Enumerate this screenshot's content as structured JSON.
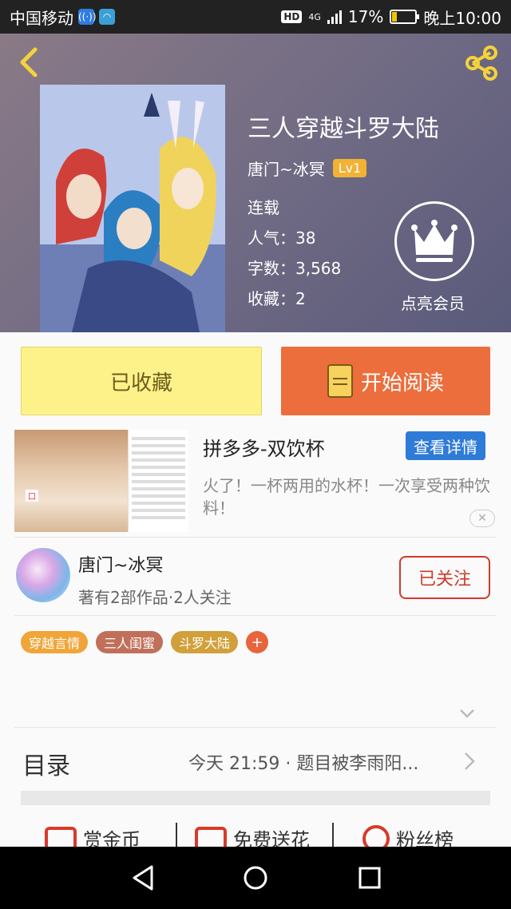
{
  "status_bar": {
    "carrier": "中国移动",
    "network": "4G",
    "battery": "17%",
    "time": "晚上10:00"
  },
  "book": {
    "title": "三人穿越斗罗大陆",
    "author": "唐门~冰冥",
    "level": "Lv1",
    "status": "连载",
    "popularity": "人气：38",
    "word_count": "字数：3,568",
    "favorites": "收藏：2",
    "member_label": "点亮会员"
  },
  "buttons": {
    "collect": "已收藏",
    "read": "开始阅读"
  },
  "ad": {
    "title": "拼多多-双饮杯",
    "detail_button": "查看详情",
    "description": "火了！一杯两用的水杯！一次享受两种饮料！",
    "close": "✕"
  },
  "author_card": {
    "name": "唐门~冰冥",
    "info": "著有2部作品·2人关注",
    "follow_label": "已关注"
  },
  "tags": [
    {
      "label": "穿越言情",
      "color": "#f0a538"
    },
    {
      "label": "三人闺蜜",
      "color": "#c0705a"
    },
    {
      "label": "斗罗大陆",
      "color": "#d1a03a"
    }
  ],
  "tag_add": "+",
  "catalog": {
    "label": "目录",
    "update": "今天 21:59 · 题目被李雨阳..."
  },
  "actions": {
    "coins": "赏金币",
    "flowers": "免费送花",
    "fans": "粉丝榜"
  },
  "colors": {
    "accent_red": "#d03a2a",
    "read_button": "#ec6e3c",
    "collect_button": "#fdf28a",
    "ad_button": "#2f7bd8"
  }
}
